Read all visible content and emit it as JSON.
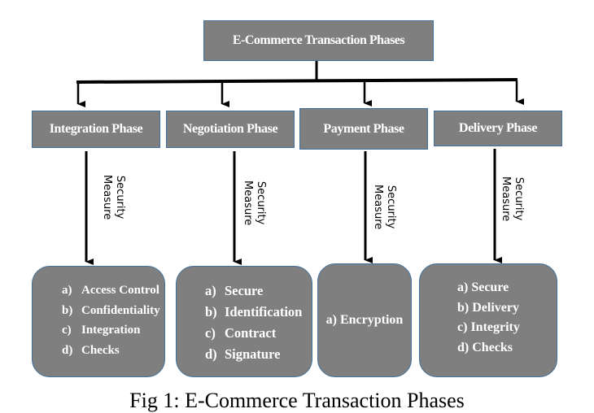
{
  "diagram": {
    "root": {
      "label": "E-Commerce Transaction Phases"
    },
    "edge_label": "Security Measure",
    "edge_label_lines": [
      "Security",
      "Measure"
    ],
    "phases": [
      {
        "label": "Integration Phase",
        "measures": [
          "Access Control",
          "Confidentiality",
          "Integration",
          "Checks"
        ],
        "markers": [
          "a)",
          "b)",
          "c)",
          "d)"
        ]
      },
      {
        "label": "Negotiation Phase",
        "measures": [
          "Secure",
          "Identification",
          "Contract",
          "Signature"
        ],
        "markers": [
          "a)",
          "b)",
          "c)",
          "d)"
        ]
      },
      {
        "label": "Payment Phase",
        "measures": [
          "Encryption"
        ],
        "markers": [
          "a)"
        ]
      },
      {
        "label": "Delivery Phase",
        "measures": [
          "Secure",
          "Delivery",
          "Integrity",
          "Checks"
        ],
        "markers": [
          "a)",
          "b)",
          "c)",
          "d)"
        ]
      }
    ],
    "caption": "Fig 1: E-Commerce Transaction Phases"
  },
  "colors": {
    "box_fill": "#7f7f7f",
    "box_border": "#41719c",
    "text": "#ffffff",
    "connector": "#000000"
  }
}
